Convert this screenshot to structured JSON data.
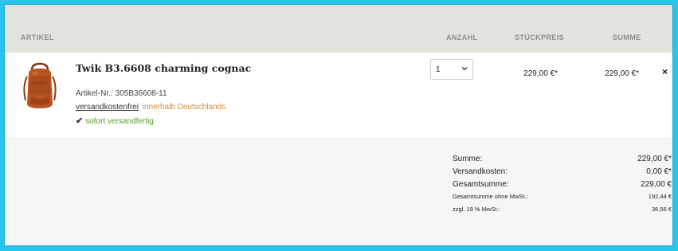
{
  "table_header": {
    "artikel": "ARTIKEL",
    "anzahl": "ANZAHL",
    "stueckpreis": "STÜCKPREIS",
    "summe": "SUMME"
  },
  "item": {
    "title": "Twik B3.6608 charming cognac",
    "artnr_label": "Artikel-Nr.:",
    "artnr_value": "305B36608-11",
    "shipping_free": "versandkostenfrei",
    "shipping_region": "innerhalb Deutschlands",
    "availability": "sofort versandfertig",
    "quantity": "1",
    "unit_price": "229,00 €*",
    "total_price": "229,00 €*",
    "remove": "×"
  },
  "summary": {
    "rows": [
      {
        "label": "Summe:",
        "value": "229,00 €*"
      },
      {
        "label": "Versandkosten:",
        "value": "0,00 €*"
      },
      {
        "label": "Gesamtsumme:",
        "value": "229,00 €"
      },
      {
        "label": "Gesamtsumme ohne MwSt.:",
        "value": "192,44 €"
      },
      {
        "label": "zzgl. 19 % MwSt.:",
        "value": "36,56 €"
      }
    ]
  },
  "colors": {
    "header_bg": "#e4e4df",
    "accent_orange": "#d68a3d",
    "available_green": "#5a9a2b",
    "frame_border": "#27c4ec"
  },
  "icons": {
    "product_image": "backpack-image",
    "availability": "check-icon",
    "quantity": "chevron-down-icon",
    "remove": "close-icon"
  }
}
